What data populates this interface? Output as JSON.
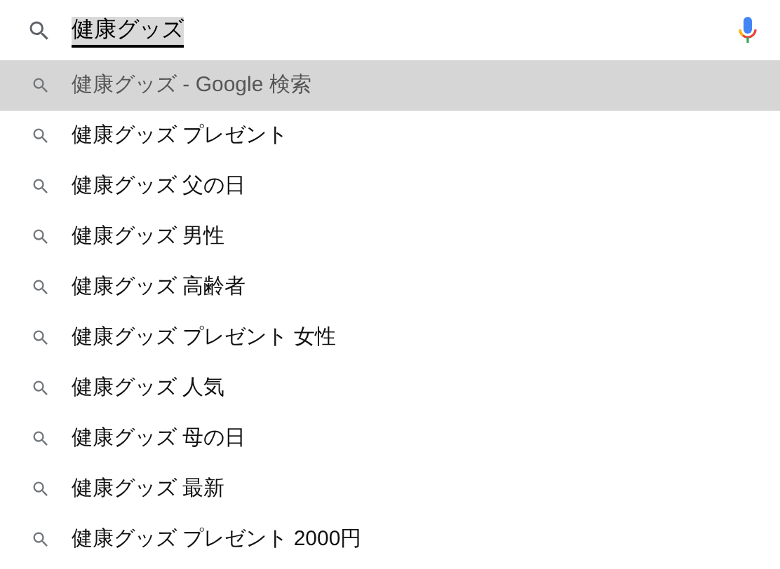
{
  "search": {
    "value": "健康グッズ"
  },
  "suggestions": [
    {
      "text": "健康グッズ - Google 検索",
      "selected": true
    },
    {
      "text": "健康グッズ プレゼント",
      "selected": false
    },
    {
      "text": "健康グッズ 父の日",
      "selected": false
    },
    {
      "text": "健康グッズ 男性",
      "selected": false
    },
    {
      "text": "健康グッズ 高齢者",
      "selected": false
    },
    {
      "text": "健康グッズ プレゼント 女性",
      "selected": false
    },
    {
      "text": "健康グッズ 人気",
      "selected": false
    },
    {
      "text": "健康グッズ 母の日",
      "selected": false
    },
    {
      "text": "健康グッズ 最新",
      "selected": false
    },
    {
      "text": "健康グッズ プレゼント 2000円",
      "selected": false
    }
  ]
}
